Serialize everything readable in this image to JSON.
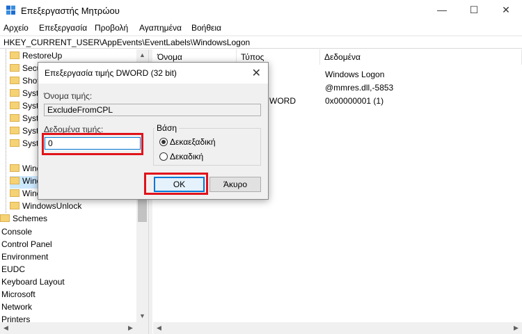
{
  "window": {
    "title": "Επεξεργαστής Μητρώου",
    "min_icon": "—",
    "max_icon": "☐",
    "close_icon": "✕"
  },
  "menu": [
    "Αρχείο",
    "Επεξεργασία",
    "Προβολή",
    "Αγαπημένα",
    "Βοήθεια"
  ],
  "address": "HKEY_CURRENT_USER\\AppEvents\\EventLabels\\WindowsLogon",
  "tree": {
    "items": [
      "RestoreUp",
      "Secu",
      "Shov",
      "Syste",
      "Syste",
      "Syste",
      "Syste",
      "Syste",
      "Wind",
      "Wind",
      "Wind",
      "WindowsUnlock"
    ],
    "items_root": [
      "Schemes"
    ],
    "top_level": [
      "Console",
      "Control Panel",
      "Environment",
      "EUDC",
      "Keyboard Layout",
      "Microsoft",
      "Network",
      "Printers"
    ]
  },
  "list": {
    "columns": [
      "Όνομα",
      "Τύπος",
      "Δεδομένα"
    ],
    "type_partial": "WORD",
    "data": [
      "Windows Logon",
      "@mmres.dll,-5853",
      "0x00000001 (1)"
    ]
  },
  "dialog": {
    "title": "Επεξεργασία τιμής DWORD (32 bit)",
    "close_icon": "✕",
    "name_label": "Όνομα τιμής:",
    "name_value": "ExcludeFromCPL",
    "data_label": "Δεδομένα τιμής:",
    "data_value": "0",
    "base_label": "Βάση",
    "radio_hex": "Δεκαεξαδική",
    "radio_dec": "Δεκαδική",
    "ok_label": "OK",
    "cancel_label": "Άκυρο"
  },
  "colors": {
    "highlight": "#e0131b",
    "accent": "#0078d7",
    "selection": "#cce8ff"
  },
  "scroll": {
    "up": "▲",
    "down": "▼",
    "left": "◀",
    "right": "▶"
  }
}
